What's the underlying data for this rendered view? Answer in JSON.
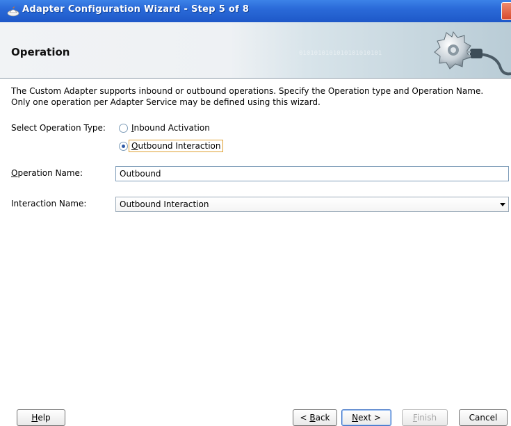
{
  "window": {
    "title": "Adapter Configuration Wizard - Step 5 of 8"
  },
  "header": {
    "title": "Operation",
    "binary_decor": "0101010101010101010101"
  },
  "description": {
    "line1": "The Custom Adapter supports inbound or outbound operations.  Specify the Operation type and Operation Name.",
    "line2": "Only one operation per Adapter Service may be defined using this wizard."
  },
  "operation_type": {
    "label": "Select Operation Type:",
    "options": [
      {
        "label_mnemonic": "I",
        "label_rest": "nbound Activation",
        "checked": false
      },
      {
        "label_mnemonic": "O",
        "label_rest": "utbound Interaction",
        "checked": true
      }
    ]
  },
  "operation_name": {
    "label_mnemonic": "O",
    "label_rest": "peration Name:",
    "value": "Outbound"
  },
  "interaction_name": {
    "label": "Interaction Name:",
    "value": "Outbound Interaction"
  },
  "buttons": {
    "help": {
      "mnemonic": "H",
      "rest": "elp"
    },
    "back": {
      "prefix": "< ",
      "mnemonic": "B",
      "rest": "ack"
    },
    "next": {
      "mnemonic": "N",
      "rest": "ext >"
    },
    "finish": {
      "mnemonic": "F",
      "rest": "inish"
    },
    "cancel": "Cancel"
  },
  "colors": {
    "titlebar": "#2a6ad8",
    "accent_focus": "#e0a030"
  }
}
